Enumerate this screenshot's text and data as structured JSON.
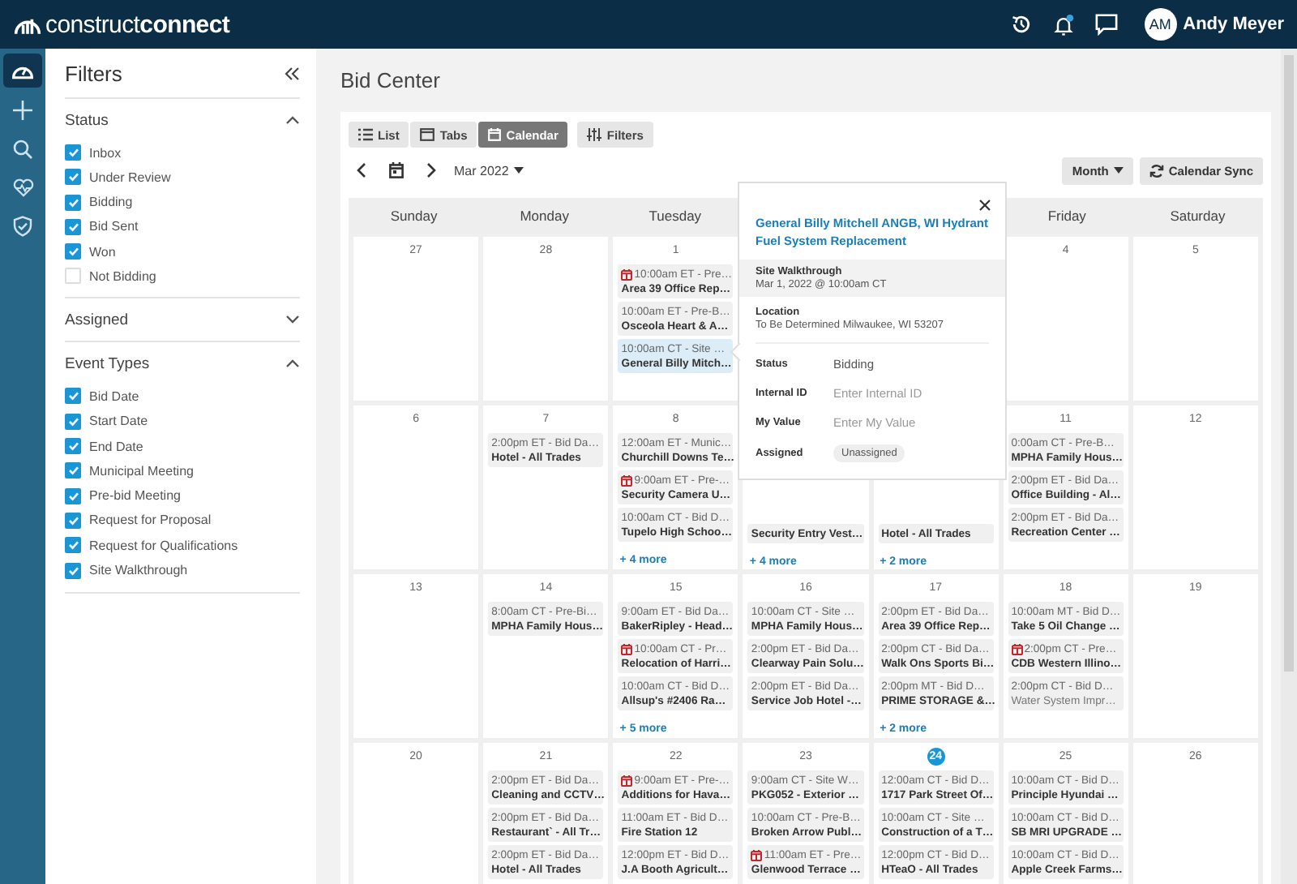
{
  "topbar": {
    "logo": "construct**connect**",
    "user": {
      "initials": "AM",
      "name": "Andy Meyer"
    },
    "notification_dot": true
  },
  "rail": {
    "items": [
      {
        "kind": "dashboard",
        "selected": true
      },
      {
        "kind": "add",
        "selected": false
      },
      {
        "kind": "search",
        "selected": false
      },
      {
        "kind": "health",
        "selected": false
      },
      {
        "kind": "shield",
        "selected": false
      }
    ]
  },
  "filters": {
    "title": "Filters",
    "sections": [
      {
        "title": "Status",
        "expanded": true,
        "options": [
          {
            "label": "Inbox",
            "checked": true
          },
          {
            "label": "Under Review",
            "checked": true
          },
          {
            "label": "Bidding",
            "checked": true
          },
          {
            "label": "Bid Sent",
            "checked": true
          },
          {
            "label": "Won",
            "checked": true
          },
          {
            "label": "Not Bidding",
            "checked": false
          }
        ]
      },
      {
        "title": "Assigned",
        "expanded": false
      },
      {
        "title": "Event Types",
        "expanded": true,
        "options": [
          {
            "label": "Bid Date",
            "checked": true
          },
          {
            "label": "Start Date",
            "checked": true
          },
          {
            "label": "End Date",
            "checked": true
          },
          {
            "label": "Municipal Meeting",
            "checked": true
          },
          {
            "label": "Pre-bid Meeting",
            "checked": true
          },
          {
            "label": "Request for Proposal",
            "checked": true
          },
          {
            "label": "Request for Qualifications",
            "checked": true
          },
          {
            "label": "Site Walkthrough",
            "checked": true
          }
        ]
      }
    ]
  },
  "page_title": "Bid Center",
  "view_tabs": [
    {
      "kind": "list",
      "label": "List",
      "selected": false
    },
    {
      "kind": "tabs",
      "label": "Tabs",
      "selected": false
    },
    {
      "kind": "calendar",
      "label": "Calendar",
      "selected": true
    }
  ],
  "filters_button": "Filters",
  "month_label": "Mar 2022",
  "view_select": "Month",
  "sync_button": "Calendar Sync",
  "weekdays": {
    "sun": "Sunday",
    "mon": "Monday",
    "tue": "Tuesday",
    "fri": "Friday",
    "sat": "Saturday"
  },
  "weeks": [
    {
      "days": {
        "sun": {
          "number": "27",
          "today": false
        },
        "mon": {
          "number": "28",
          "today": false
        },
        "tue": {
          "number": "1",
          "today": false,
          "events": [
            {
              "time": "10:00am ET - Pre…",
              "title": "Area 39 Office Rep…",
              "calendar_icon": true,
              "selected": false,
              "muted": false
            },
            {
              "time": "10:00am ET - Pre-B…",
              "title": "Osceola Heart & A…",
              "calendar_icon": false,
              "selected": false,
              "muted": false
            },
            {
              "time": "10:00am CT - Site …",
              "title": "General Billy Mitch…",
              "calendar_icon": false,
              "selected": true,
              "muted": false
            }
          ]
        },
        "fri": {
          "number": "4",
          "today": false
        },
        "sat": {
          "number": "5",
          "today": false
        }
      }
    },
    {
      "days": {
        "sun": {
          "number": "6",
          "today": false
        },
        "mon": {
          "number": "7",
          "today": false,
          "events": [
            {
              "time": "2:00pm ET - Bid Da…",
              "title": "Hotel - All Trades",
              "calendar_icon": false,
              "selected": false,
              "muted": false
            }
          ]
        },
        "tue": {
          "number": "8",
          "today": false,
          "events": [
            {
              "time": "12:00am ET - Munic…",
              "title": "Churchill Downs Te…",
              "calendar_icon": false,
              "selected": false,
              "muted": false
            },
            {
              "time": "9:00am ET - Pre-…",
              "title": "Security Camera U…",
              "calendar_icon": true,
              "selected": false,
              "muted": false
            },
            {
              "time": "10:00am CT - Bid D…",
              "title": "Tupelo High Schoo…",
              "calendar_icon": false,
              "selected": false,
              "muted": false
            }
          ],
          "more": "+ 4 more"
        },
        "wed": {
          "events": [
            {
              "title": "Security Entry Vest…",
              "selected": false,
              "muted": false
            }
          ],
          "more": "+ 4 more"
        },
        "thu": {
          "events": [
            {
              "title": "Hotel - All Trades",
              "selected": false,
              "muted": false
            }
          ],
          "more": "+ 2 more"
        },
        "fri": {
          "number": "11",
          "today": false,
          "events": [
            {
              "time": "0:00am CT - Pre-B…",
              "title": "MPHA Family Hous…",
              "calendar_icon": false,
              "selected": false,
              "muted": false
            },
            {
              "time": "2:00pm ET - Bid Da…",
              "title": "Office Building - Al…",
              "calendar_icon": false,
              "selected": false,
              "muted": false
            },
            {
              "time": "2:00pm ET - Bid Da…",
              "title": "Recreation Center …",
              "calendar_icon": false,
              "selected": false,
              "muted": false
            }
          ]
        },
        "sat": {
          "number": "12",
          "today": false
        }
      }
    },
    {
      "days": {
        "sun": {
          "number": "13",
          "today": false
        },
        "mon": {
          "number": "14",
          "today": false,
          "events": [
            {
              "time": "8:00am CT - Pre-Bi…",
              "title": "MPHA Family Hous…",
              "calendar_icon": false,
              "selected": false,
              "muted": false
            }
          ]
        },
        "tue": {
          "number": "15",
          "today": false,
          "events": [
            {
              "time": "9:00am ET - Bid Da…",
              "title": "BakerRipley - Head…",
              "calendar_icon": false,
              "selected": false,
              "muted": false
            },
            {
              "time": "10:00am CT - Pr…",
              "title": "Relocation of Harri…",
              "calendar_icon": true,
              "selected": false,
              "muted": false
            },
            {
              "time": "10:00am CT - Bid D…",
              "title": "Allsup's #2406 Ra…",
              "calendar_icon": false,
              "selected": false,
              "muted": false
            }
          ],
          "more": "+ 5 more"
        },
        "wed": {
          "number": "16",
          "today": false,
          "events": [
            {
              "time": "10:00am CT - Site …",
              "title": "MPHA Family Hous…",
              "calendar_icon": false,
              "selected": false,
              "muted": false
            },
            {
              "time": "2:00pm ET - Bid Da…",
              "title": "Clearway Pain Solu…",
              "calendar_icon": false,
              "selected": false,
              "muted": false
            },
            {
              "time": "2:00pm ET - Bid Da…",
              "title": "Service Job Hotel -…",
              "calendar_icon": false,
              "selected": false,
              "muted": false
            }
          ]
        },
        "thu": {
          "number": "17",
          "today": false,
          "events": [
            {
              "time": "2:00pm ET - Bid Da…",
              "title": "Area 39 Office Rep…",
              "calendar_icon": false,
              "selected": false,
              "muted": false
            },
            {
              "time": "2:00pm CT - Bid Da…",
              "title": "Walk Ons Sports Bi…",
              "calendar_icon": false,
              "selected": false,
              "muted": false
            },
            {
              "time": "2:00pm MT - Bid D…",
              "title": "PRIME STORAGE &…",
              "calendar_icon": false,
              "selected": false,
              "muted": false
            }
          ],
          "more": "+ 2 more"
        },
        "fri": {
          "number": "18",
          "today": false,
          "events": [
            {
              "time": "10:00am MT - Bid D…",
              "title": "Take 5 Oil Change …",
              "calendar_icon": false,
              "selected": false,
              "muted": false
            },
            {
              "time": "2:00pm CT - Pre…",
              "title": "CDB Western Illino…",
              "calendar_icon": true,
              "selected": false,
              "muted": false
            },
            {
              "time": "2:00pm CT - Bid D…",
              "title": "Water System Impr…",
              "calendar_icon": false,
              "selected": false,
              "muted": true
            }
          ]
        },
        "sat": {
          "number": "19",
          "today": false
        }
      }
    },
    {
      "days": {
        "sun": {
          "number": "20",
          "today": false
        },
        "mon": {
          "number": "21",
          "today": false,
          "events": [
            {
              "time": "2:00pm ET - Bid Da…",
              "title": "Cleaning and CCTV…",
              "calendar_icon": false,
              "selected": false,
              "muted": false
            },
            {
              "time": "2:00pm ET - Bid Da…",
              "title": "Restaurant` - All Tr…",
              "calendar_icon": false,
              "selected": false,
              "muted": false
            },
            {
              "time": "2:00pm ET - Bid Da…",
              "title": "Hotel - All Trades",
              "calendar_icon": false,
              "selected": false,
              "muted": false
            }
          ]
        },
        "tue": {
          "number": "22",
          "today": false,
          "events": [
            {
              "time": "9:00am ET - Pre-…",
              "title": "Additions for Hava…",
              "calendar_icon": true,
              "selected": false,
              "muted": false
            },
            {
              "time": "11:00am ET - Bid D…",
              "title": "Fire Station 12",
              "calendar_icon": false,
              "selected": false,
              "muted": false
            },
            {
              "time": "12:00pm ET - Bid D…",
              "title": "J.A Booth Agricult…",
              "calendar_icon": false,
              "selected": false,
              "muted": false
            }
          ]
        },
        "wed": {
          "number": "23",
          "today": false,
          "events": [
            {
              "time": "9:00am CT - Site W…",
              "title": "PKG052 - Exterior …",
              "calendar_icon": false,
              "selected": false,
              "muted": false
            },
            {
              "time": "10:00am CT - Pre-B…",
              "title": "Broken Arrow Publ…",
              "calendar_icon": false,
              "selected": false,
              "muted": false
            },
            {
              "time": "11:00am ET - Pre…",
              "title": "Glenwood Terrace …",
              "calendar_icon": true,
              "selected": false,
              "muted": false
            }
          ]
        },
        "thu": {
          "number": "24",
          "today": true,
          "events": [
            {
              "time": "12:00am CT - Bid D…",
              "title": "1717 Park Street Of…",
              "calendar_icon": false,
              "selected": false,
              "muted": false
            },
            {
              "time": "10:00am CT - Site …",
              "title": "Construction of a T…",
              "calendar_icon": false,
              "selected": false,
              "muted": false
            },
            {
              "time": "12:00pm CT - Bid D…",
              "title": "HTeaO - All Trades",
              "calendar_icon": false,
              "selected": false,
              "muted": false
            }
          ]
        },
        "fri": {
          "number": "25",
          "today": false,
          "events": [
            {
              "time": "10:00am CT - Bid D…",
              "title": "Principle Hyundai …",
              "calendar_icon": false,
              "selected": false,
              "muted": false
            },
            {
              "time": "10:00am CT - Bid D…",
              "title": "SB MRI UPGRADE …",
              "calendar_icon": false,
              "selected": false,
              "muted": false
            },
            {
              "time": "10:00am CT - Bid D…",
              "title": "Apple Creek Farms…",
              "calendar_icon": false,
              "selected": false,
              "muted": false
            }
          ]
        },
        "sat": {
          "number": "26",
          "today": false
        }
      }
    }
  ],
  "popup": {
    "title": "General Billy Mitchell ANGB, WI Hydrant Fuel System Replacement",
    "event_type": "Site Walkthrough",
    "event_date": "Mar 1, 2022 @ 10:00am CT",
    "location_label": "Location",
    "location": "To Be Determined Milwaukee, WI 53207",
    "fields": [
      {
        "label": "Status",
        "kind": "text",
        "value": "Bidding"
      },
      {
        "label": "Internal ID",
        "kind": "input",
        "placeholder": "Enter Internal ID"
      },
      {
        "label": "My Value",
        "kind": "input",
        "placeholder": "Enter My Value"
      },
      {
        "label": "Assigned",
        "kind": "chip",
        "value": "Unassigned"
      }
    ]
  }
}
